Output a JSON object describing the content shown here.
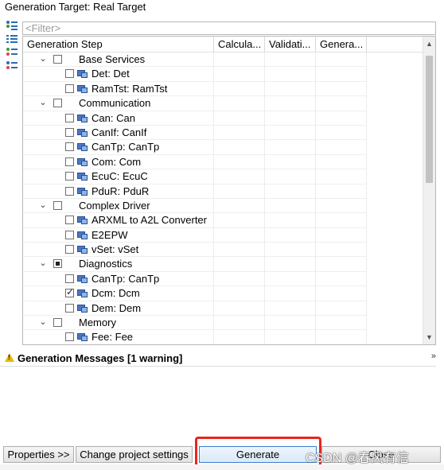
{
  "window": {
    "title": "Generation Target: Real Target"
  },
  "toolbar_icons": [
    "expand-all-icon",
    "collapse-all-icon",
    "select-all-icon",
    "deselect-all-icon"
  ],
  "filter": {
    "placeholder": "<Filter>",
    "value": ""
  },
  "tree": {
    "columns": [
      "Generation Step",
      "Calcula...",
      "Validati...",
      "Genera..."
    ],
    "rows": [
      {
        "level": 0,
        "expanded": true,
        "state": "unchecked",
        "label": "Base Services",
        "icon": false
      },
      {
        "level": 1,
        "state": "unchecked",
        "label": "Det: Det",
        "icon": true
      },
      {
        "level": 1,
        "state": "unchecked",
        "label": "RamTst: RamTst",
        "icon": true
      },
      {
        "level": 0,
        "expanded": true,
        "state": "unchecked",
        "label": "Communication",
        "icon": false
      },
      {
        "level": 1,
        "state": "unchecked",
        "label": "Can: Can",
        "icon": true
      },
      {
        "level": 1,
        "state": "unchecked",
        "label": "CanIf: CanIf",
        "icon": true
      },
      {
        "level": 1,
        "state": "unchecked",
        "label": "CanTp: CanTp",
        "icon": true
      },
      {
        "level": 1,
        "state": "unchecked",
        "label": "Com: Com",
        "icon": true
      },
      {
        "level": 1,
        "state": "unchecked",
        "label": "EcuC: EcuC",
        "icon": true
      },
      {
        "level": 1,
        "state": "unchecked",
        "label": "PduR: PduR",
        "icon": true
      },
      {
        "level": 0,
        "expanded": true,
        "state": "unchecked",
        "label": "Complex Driver",
        "icon": false
      },
      {
        "level": 1,
        "state": "unchecked",
        "label": "ARXML to A2L Converter",
        "icon": true
      },
      {
        "level": 1,
        "state": "unchecked",
        "label": "E2EPW",
        "icon": true
      },
      {
        "level": 1,
        "state": "unchecked",
        "label": "vSet: vSet",
        "icon": true
      },
      {
        "level": 0,
        "expanded": true,
        "state": "partial",
        "label": "Diagnostics",
        "icon": false
      },
      {
        "level": 1,
        "state": "unchecked",
        "label": "CanTp: CanTp",
        "icon": true
      },
      {
        "level": 1,
        "state": "checked",
        "label": "Dcm: Dcm",
        "icon": true
      },
      {
        "level": 1,
        "state": "unchecked",
        "label": "Dem: Dem",
        "icon": true
      },
      {
        "level": 0,
        "expanded": true,
        "state": "unchecked",
        "label": "Memory",
        "icon": false
      },
      {
        "level": 1,
        "state": "unchecked",
        "label": "Fee: Fee",
        "icon": true
      }
    ]
  },
  "messages": {
    "title": "Generation Messages [1 warning]",
    "severity_color": "#e6b800"
  },
  "buttons": {
    "properties": "Properties >>",
    "change_settings": "Change project settings",
    "generate": "Generate",
    "close": "Close"
  },
  "watermark": "CSDN @春风有信",
  "colors": {
    "highlight": "#e8261d",
    "accent": "#3c7fd0"
  }
}
